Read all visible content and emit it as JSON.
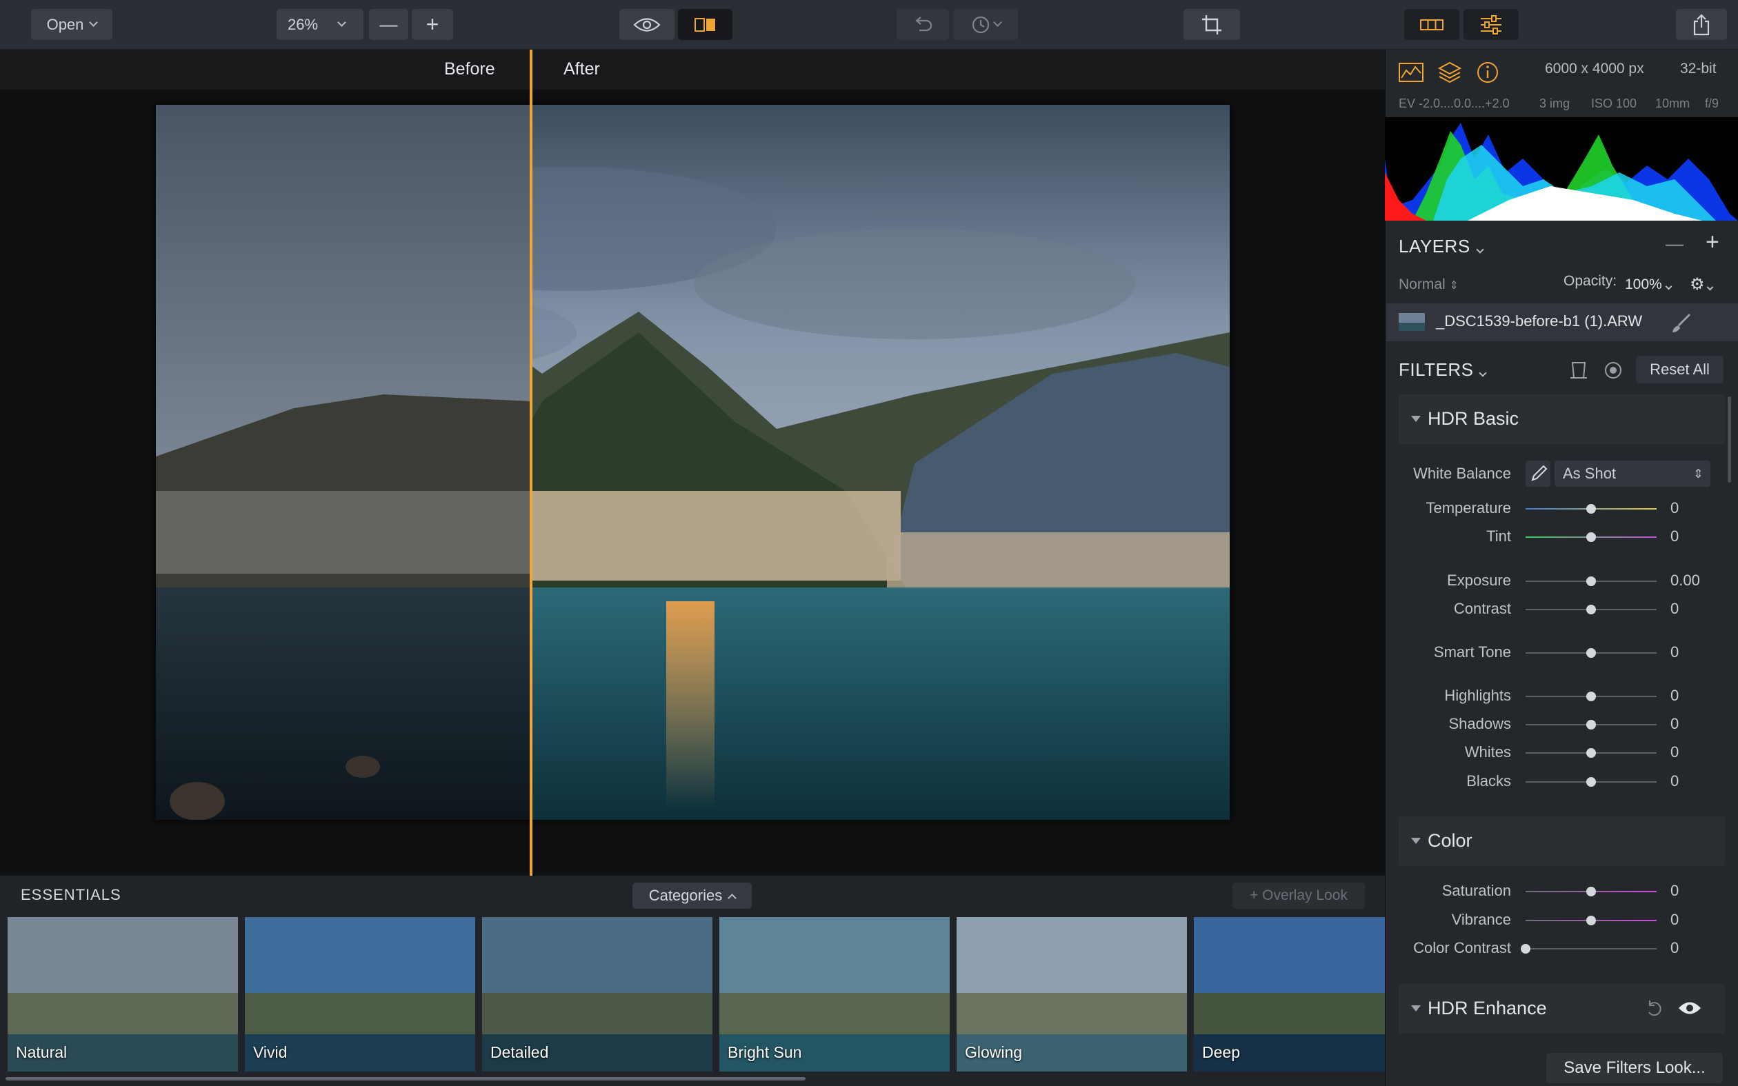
{
  "toolbar": {
    "open_label": "Open",
    "zoom_value": "26%",
    "zoom_out_label": "—",
    "zoom_in_label": "+",
    "accent": "#f0a533"
  },
  "compare": {
    "before_label": "Before",
    "after_label": "After"
  },
  "info": {
    "dimensions": "6000 x 4000 px",
    "bit_depth": "32-bit",
    "ev_range": "EV  -2.0....0.0....+2.0",
    "image_count": "3 img",
    "iso": "ISO 100",
    "focal_length": "10mm",
    "aperture": "f/9"
  },
  "layers": {
    "title": "LAYERS",
    "remove_label": "—",
    "add_label": "+",
    "blend_mode": "Normal",
    "opacity_label": "Opacity:",
    "opacity_value": "100%",
    "layer_name": "_DSC1539-before-b1 (1).ARW"
  },
  "filters": {
    "title": "FILTERS",
    "reset_label": "Reset All",
    "save_look_label": "Save Filters Look...",
    "groups": [
      {
        "title": "HDR Basic"
      },
      {
        "title": "Color"
      },
      {
        "title": "HDR Enhance"
      }
    ],
    "white_balance": {
      "label": "White Balance",
      "value": "As Shot"
    },
    "sliders": [
      {
        "label": "Temperature",
        "value": "0",
        "position": 0.5
      },
      {
        "label": "Tint",
        "value": "0",
        "position": 0.5
      },
      {
        "label": "Exposure",
        "value": "0.00",
        "position": 0.5
      },
      {
        "label": "Contrast",
        "value": "0",
        "position": 0.5
      },
      {
        "label": "Smart Tone",
        "value": "0",
        "position": 0.5
      },
      {
        "label": "Highlights",
        "value": "0",
        "position": 0.5
      },
      {
        "label": "Shadows",
        "value": "0",
        "position": 0.5
      },
      {
        "label": "Whites",
        "value": "0",
        "position": 0.5
      },
      {
        "label": "Blacks",
        "value": "0",
        "position": 0.5
      },
      {
        "label": "Saturation",
        "value": "0",
        "position": 0.5
      },
      {
        "label": "Vibrance",
        "value": "0",
        "position": 0.5
      },
      {
        "label": "Color Contrast",
        "value": "0",
        "position": 0.0
      }
    ]
  },
  "filmstrip": {
    "title": "ESSENTIALS",
    "categories_label": "Categories",
    "overlay_label": "+ Overlay Look",
    "looks": [
      "Natural",
      "Vivid",
      "Detailed",
      "Bright Sun",
      "Glowing",
      "Deep"
    ]
  }
}
